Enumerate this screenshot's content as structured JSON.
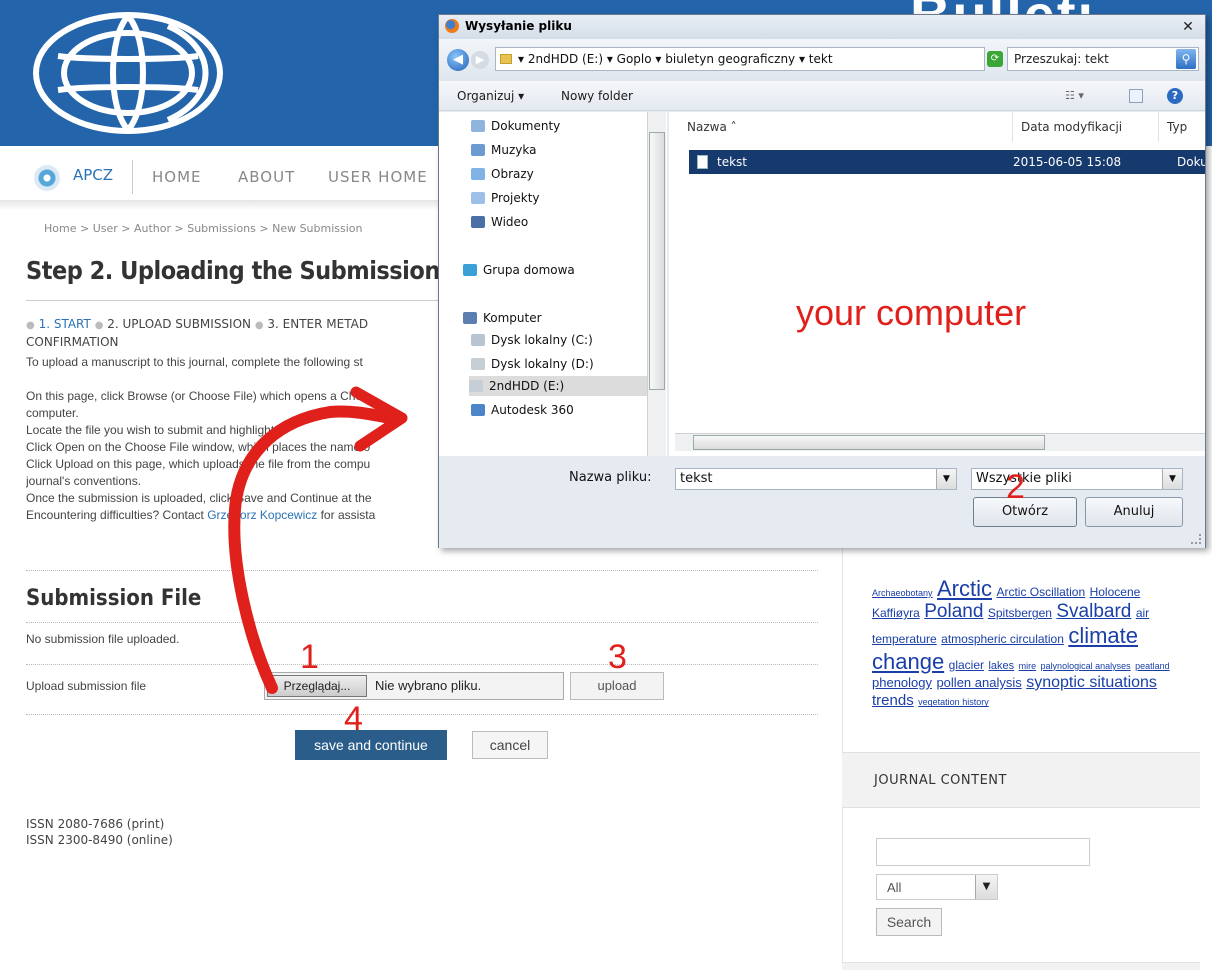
{
  "header": {
    "banner_text": "Bulleti",
    "nav": {
      "brand": "APCZ",
      "items": [
        "HOME",
        "ABOUT",
        "USER HOME"
      ]
    }
  },
  "breadcrumb": "Home > User > Author > Submissions > New Submission",
  "page_title": "Step 2. Uploading the Submission",
  "steps": {
    "step1": "1. START",
    "step2": "2. UPLOAD SUBMISSION",
    "step3": "3. ENTER METAD",
    "step_last": "CONFIRMATION"
  },
  "instructions": {
    "intro": "To upload a manuscript to this journal, complete the following st",
    "line1a": "On this page, click Browse (or Choose File) which opens a Choo",
    "line1b": "computer.",
    "line2": "Locate the file you wish to submit and highlight it.",
    "line3": "Click Open on the Choose File window, which places the name o",
    "line4": "Click Upload on this page, which uploads the file from the compu",
    "line4b": "journal's conventions.",
    "line5": "Once the submission is uploaded, click Save and Continue at the",
    "line6_pre": "Encountering difficulties? Contact ",
    "line6_link": "Grzegorz Kopcewicz",
    "line6_post": " for assista"
  },
  "submission": {
    "section_title": "Submission File",
    "no_file": "No submission file uploaded.",
    "upload_label": "Upload submission file",
    "browse_label": "Przeglądaj...",
    "file_status": "Nie wybrano pliku.",
    "upload_button": "upload",
    "save_button": "save and continue",
    "cancel_button": "cancel"
  },
  "footer": {
    "issn_print": "ISSN 2080-7686 (print)",
    "issn_online": "ISSN 2300-8490 (online)"
  },
  "sidebar": {
    "tags": [
      {
        "text": "Archaeobotany",
        "size": 9
      },
      {
        "text": "Arctic",
        "size": 22
      },
      {
        "text": "Arctic Oscillation",
        "size": 12
      },
      {
        "text": "Holocene",
        "size": 12
      },
      {
        "text": "Kaffiøyra",
        "size": 12
      },
      {
        "text": "Poland",
        "size": 19
      },
      {
        "text": "Spitsbergen",
        "size": 12
      },
      {
        "text": "Svalbard",
        "size": 19
      },
      {
        "text": "air temperature",
        "size": 12
      },
      {
        "text": "atmospheric circulation",
        "size": 12
      },
      {
        "text": "climate change",
        "size": 22
      },
      {
        "text": "glacier",
        "size": 12
      },
      {
        "text": "lakes",
        "size": 11
      },
      {
        "text": "mire",
        "size": 9
      },
      {
        "text": "palynological analyses",
        "size": 9
      },
      {
        "text": "peatland",
        "size": 9
      },
      {
        "text": "phenology",
        "size": 13
      },
      {
        "text": "pollen analysis",
        "size": 13
      },
      {
        "text": "synoptic situations",
        "size": 16
      },
      {
        "text": "trends",
        "size": 15
      },
      {
        "text": "vegetation history",
        "size": 9
      }
    ],
    "journal_content_title": "JOURNAL CONTENT",
    "search_scope": "All",
    "search_button": "Search"
  },
  "dialog": {
    "title": "Wysyłanie pliku",
    "close": "✕",
    "address_path": "▾ 2ndHDD (E:) ▾ Goplo ▾ biuletyn geograficzny ▾ tekt",
    "search_placeholder": "Przeszukaj: tekt",
    "toolbar": {
      "organize": "Organizuj ▾",
      "new_folder": "Nowy folder"
    },
    "left_items": [
      {
        "label": "Dokumenty",
        "color": "#8fb4de"
      },
      {
        "label": "Muzyka",
        "color": "#6c9bd2"
      },
      {
        "label": "Obrazy",
        "color": "#7fb3e6"
      },
      {
        "label": "Projekty",
        "color": "#9cc0e8"
      },
      {
        "label": "Wideo",
        "color": "#4a6fa5"
      },
      {
        "label": "Grupa domowa",
        "color": "#3aa0d8"
      },
      {
        "label": "Komputer",
        "color": "#5b7fb0"
      },
      {
        "label": "Dysk lokalny (C:)",
        "color": "#b8c4cf"
      },
      {
        "label": "Dysk lokalny (D:)",
        "color": "#c6ced6"
      },
      {
        "label": "2ndHDD (E:)",
        "color": "#c6ced6"
      },
      {
        "label": "Autodesk 360",
        "color": "#4d86c8"
      }
    ],
    "columns": {
      "name": "Nazwa",
      "modified": "Data modyfikacji",
      "type": "Typ"
    },
    "file": {
      "name": "tekst",
      "modified": "2015-06-05 15:08",
      "type": "Dokum"
    },
    "filename_label": "Nazwa pliku:",
    "filename_value": "tekst",
    "filter_value": "Wszystkie pliki",
    "open_button": "Otwórz",
    "cancel_button": "Anuluj"
  },
  "annotations": {
    "your_computer": "your computer",
    "n1": "1",
    "n2": "2",
    "n3": "3",
    "n4": "4"
  },
  "colors": {
    "banner": "#2364aa",
    "annotation_red": "#e0201b",
    "link": "#2b73b5",
    "selected_row": "#163a6d"
  }
}
